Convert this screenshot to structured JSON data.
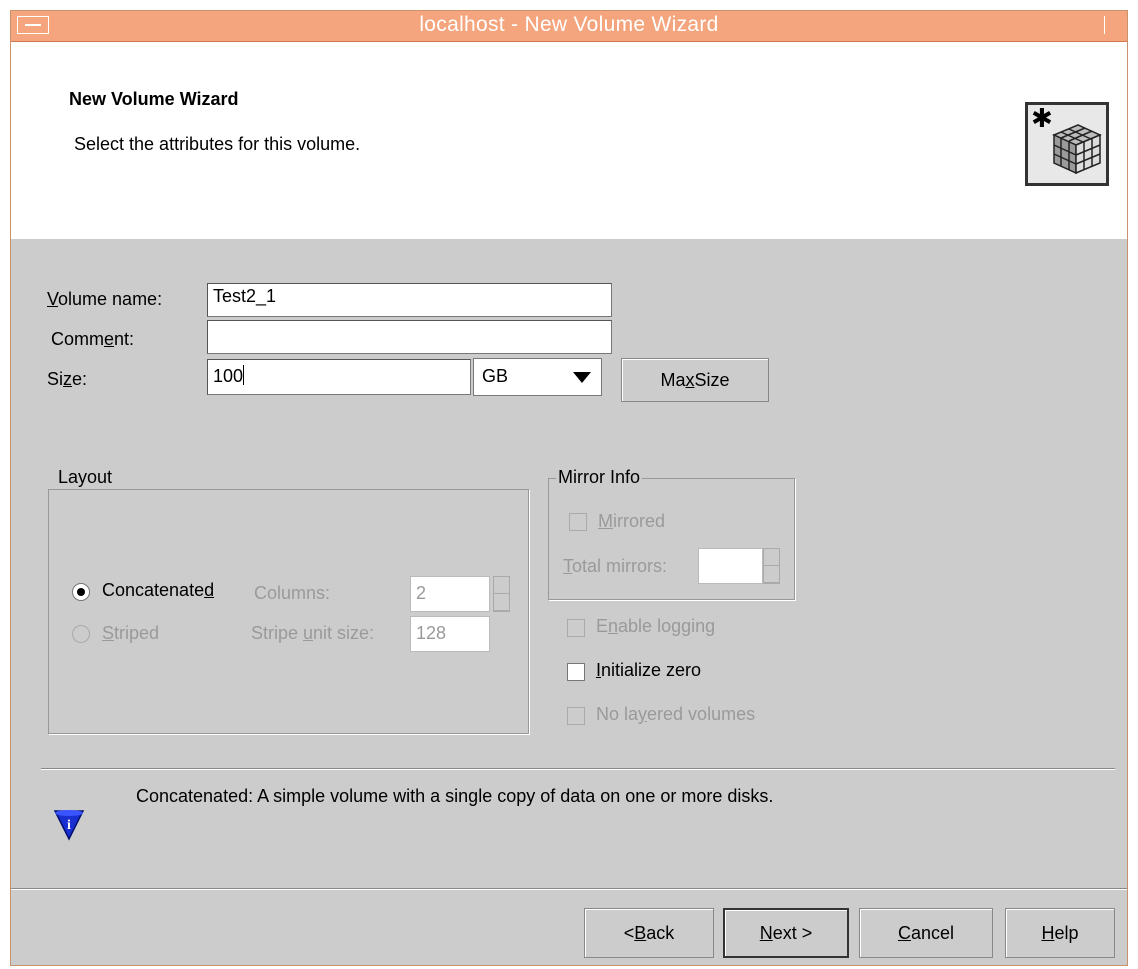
{
  "window": {
    "title": "localhost - New Volume Wizard"
  },
  "header": {
    "title": "New Volume Wizard",
    "subtitle": "Select the attributes for this volume."
  },
  "form": {
    "volume_name": {
      "label_pre": "",
      "label_mn": "V",
      "label_post": "olume name:",
      "value": "Test2_1"
    },
    "comment": {
      "label_pre": "Comm",
      "label_mn": "e",
      "label_post": "nt:",
      "value": ""
    },
    "size": {
      "label_pre": "Si",
      "label_mn": "z",
      "label_post": "e:",
      "value": "100",
      "unit": "GB"
    },
    "max_size": {
      "pre": "Ma",
      "mn": "x",
      "post": " Size"
    }
  },
  "layout": {
    "legend": "Layout",
    "concatenated": {
      "pre": "Concatenate",
      "mn": "d",
      "post": ""
    },
    "striped": {
      "pre": "",
      "mn": "S",
      "post": "triped"
    },
    "columns_label": "Columns:",
    "columns_value": "2",
    "stripe_unit": {
      "pre": "Stripe ",
      "mn": "u",
      "post": "nit size:"
    },
    "stripe_unit_value": "128"
  },
  "mirror": {
    "legend": "Mirror Info",
    "mirrored": {
      "pre": "",
      "mn": "M",
      "post": "irrored"
    },
    "total_mirrors": {
      "pre": "",
      "mn": "T",
      "post": "otal mirrors:"
    }
  },
  "options": {
    "enable_logging": {
      "pre": "E",
      "mn": "n",
      "post": "able logging"
    },
    "initialize_zero": {
      "pre": "",
      "mn": "I",
      "post": "nitialize zero"
    },
    "no_layered": {
      "pre": "No la",
      "mn": "y",
      "post": "ered volumes"
    }
  },
  "info_text": "Concatenated: A simple volume with a single copy of data on one or more disks.",
  "buttons": {
    "back": {
      "pre": "< ",
      "mn": "B",
      "post": "ack"
    },
    "next": {
      "pre": "",
      "mn": "N",
      "post": "ext >"
    },
    "cancel": {
      "pre": "",
      "mn": "C",
      "post": "ancel"
    },
    "help": {
      "pre": "",
      "mn": "H",
      "post": "elp"
    }
  },
  "colors": {
    "titlebar": "#f4a57d",
    "body": "#cccccc",
    "info_icon": "#1a2fd0"
  }
}
